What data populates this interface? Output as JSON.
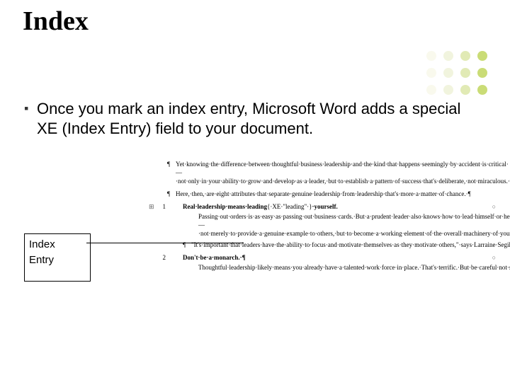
{
  "title": "Index",
  "bullet": "Once you mark an index entry, Microsoft Word adds a special XE (Index Entry) field to your document.",
  "callout": {
    "line1": "Index",
    "line2": "Entry"
  },
  "dots": {
    "colors": [
      "#e6e6b8",
      "#d8e0a0",
      "#c8d878",
      "#b8d048",
      "#e6e6b8",
      "#d8e0a0",
      "#c8d878",
      "#b8d048",
      "#e6e6b8",
      "#d8e0a0",
      "#c8d878",
      "#b8d048"
    ],
    "opacities": [
      0.25,
      0.35,
      0.55,
      0.75,
      0.25,
      0.35,
      0.55,
      0.75,
      0.25,
      0.35,
      0.55,
      0.75
    ]
  },
  "doc": {
    "p1": "Yet·knowing·the·difference·between·thoughtful·business·leadership·and·the·kind·that·happens·seemingly·by·accident·is·critical·—·not·only·in·your·ability·to·grow·and·develop·as·a·leader,·but·to·establish·a·pattern·of·success·that's·deliberate,·not·miraculous.·¶",
    "p2": "Here,·then,·are·eight·attributes·that·separate·genuine·leadership·from·leadership·that's·more·a·matter·of·chance.·¶",
    "item1": {
      "num": "1",
      "title_pre": "Real·leadership·means·leading",
      "xe": "{·XE·\"leading\"·}",
      "title_post": "·yourself.",
      "body": "Passing·out·orders·is·as·easy·as·passing·out·business·cards.·But·a·prudent·leader·also·knows·how·to·lead·himself·or·herself·—·not·merely·to·provide·a·genuine·example·to·others,·but·to·become·a·working·element·of·the·overall·machinery·of·your·business.¶",
      "quote": "\"It's·important·that·leaders·have·the·ability·to·focus·and·motivate·themselves·as·they·motivate·others,\"·says·Larraine·Segil,·an·author·and·consultant·who·teaches·executive·education·at·the·California·Institute·of·Technology·in·Pasadena.¶"
    },
    "item2": {
      "num": "2",
      "title": "Don't·be·a·monarch.·¶",
      "body": "Thoughtful·leadership·likely·means·you·already·have·a·talented·work·force·in·place.·That's·terrific.·But·be·careful·not·set·up·a·throne·room·in·the·process.·Accidental·leaders·often·inadvertently·establish·a·system·of·guidance·that's·unnecessarily·restrictive.·¶"
    }
  }
}
